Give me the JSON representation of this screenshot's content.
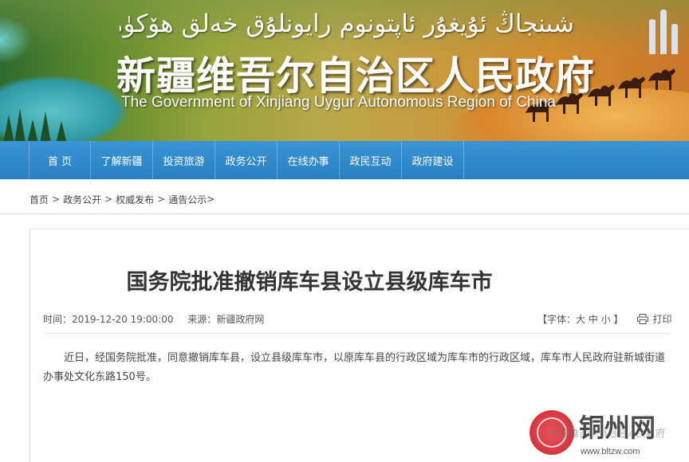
{
  "banner": {
    "uyghur_title": "شىنجاڭ ئۇيغۇر ئاپتونوم رايونلۇق خەلق ھۆكۈمىتى",
    "chinese_title": "新疆维吾尔自治区人民政府",
    "english_title": "The Government of Xinjiang Uygur Autonomous Region of China"
  },
  "nav": {
    "items": [
      {
        "label": "首 页"
      },
      {
        "label": "了解新疆"
      },
      {
        "label": "投资旅游"
      },
      {
        "label": "政务公开"
      },
      {
        "label": "在线办事"
      },
      {
        "label": "政民互动"
      },
      {
        "label": "政府建设"
      }
    ]
  },
  "breadcrumb": {
    "items": [
      "首页",
      "政务公开",
      "权威发布",
      "通告公示"
    ],
    "separator": ">",
    "trailing": ">"
  },
  "article": {
    "title": "国务院批准撤销库车县设立县级库车市",
    "time_label": "时间：",
    "time_value": "2019-12-20 19:00:00",
    "source_label": "来源：",
    "source_value": "新疆政府网",
    "font_size_label": "【字体：大 中 小 】",
    "print_label": "打印",
    "body": "近日，经国务院批准，同意撤销库车县，设立县级库车市，以原库车县的行政区域为库车市的行政区域，库车市人民政府驻新城街道办事处文化东路150号。"
  },
  "watermark": {
    "brand": "铜州网",
    "faint_text": "新疆维吾尔自治区人民政府",
    "url": "www.bltzw.com"
  },
  "colors": {
    "nav_bg": "#2a7fc1",
    "banner_warm": "#d58a2d",
    "seal_red": "#d0202b"
  },
  "icons": [
    "printer-icon",
    "seal-icon"
  ]
}
